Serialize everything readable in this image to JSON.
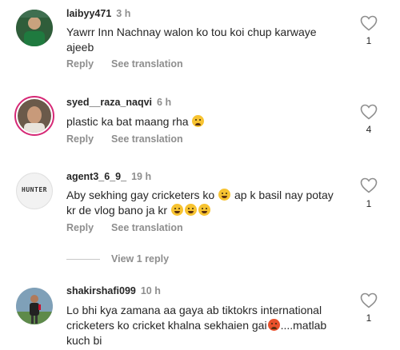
{
  "comments": [
    {
      "username": "laibyy471",
      "time": "3 h",
      "text_line1": "Yawrr Inn Nachnay walon ko tou koi chup karwaye",
      "text_line2": "ajeeb",
      "reply_label": "Reply",
      "translate_label": "See translation",
      "like_count": "1"
    },
    {
      "username": "syed__raza_naqvi",
      "time": "6 h",
      "text": "plastic ka bat maang rha",
      "reply_label": "Reply",
      "translate_label": "See translation",
      "like_count": "4"
    },
    {
      "username": "agent3_6_9_",
      "time": "19 h",
      "text_line1_a": "Aby sekhing gay cricketers ko",
      "text_line1_b": "ap k basil nay potay",
      "text_line2": "kr de vlog bano ja kr",
      "avatar_label": "HUNTER",
      "reply_label": "Reply",
      "translate_label": "See translation",
      "like_count": "1"
    },
    {
      "username": "shakirshafi099",
      "time": "10 h",
      "text_line1": "Lo bhi kya zamana aa gaya ab tiktokrs international",
      "text_line2_a": "cricketers ko cricket khalna sekhaien gai",
      "text_line2_b": "....matlab",
      "text_line3": "kuch bi",
      "like_count": "1"
    }
  ],
  "view_replies_label": "View 1 reply",
  "icons": {
    "like": "heart-outline-icon",
    "emoji_sad": "disappointed-face-icon",
    "emoji_laugh": "laughing-face-icon",
    "emoji_rofl": "rolling-laughing-face-icon",
    "emoji_angry": "angry-face-icon"
  },
  "colors": {
    "muted_text": "#8e8e8e",
    "story_ring": "#d62976"
  }
}
